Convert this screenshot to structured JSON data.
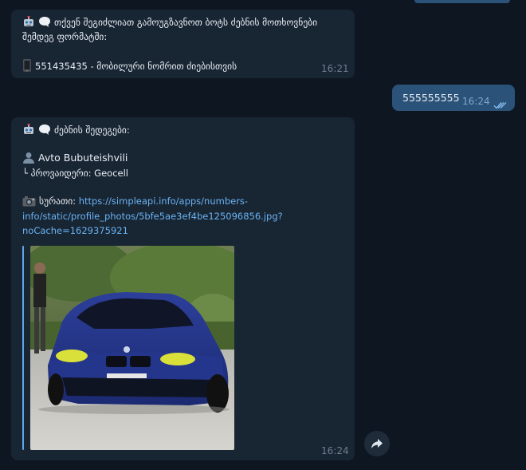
{
  "messages": {
    "bot_prompt": {
      "line1": "თქვენ შეგიძლიათ გამოუგზავნოთ ბოტს ძებნის მოთხოვნები",
      "line2": "შემდეგ ფორმატში:",
      "phone_example": "551435435 - მობილური ნომრით ძიებისთვის",
      "time": "16:21"
    },
    "user_query": {
      "text": "555555555",
      "time": "16:24"
    },
    "bot_result": {
      "header": "ძებნის შედეგები:",
      "name": "Avto Bubuteishvili",
      "provider": "└ პროვაიდერი: Geocell",
      "photo_label": "სურათი: ",
      "link_line1": "https://simpleapi.info/apps/numbers-",
      "link_line2": "info/static/profile_photos/5bfe5ae3ef4be125096856.jpg?",
      "link_line3": "noCache=1629375921",
      "time": "16:24"
    }
  },
  "colors": {
    "background": "#0e1621",
    "incoming_bubble": "#182533",
    "outgoing_bubble": "#2b5278",
    "link": "#6ab3f3"
  },
  "icons": {
    "robot": "robot-icon",
    "speech": "speech-bubble-icon",
    "phone": "mobile-phone-icon",
    "person": "person-icon",
    "camera": "camera-icon",
    "read": "double-check-icon",
    "forward": "forward-arrow-icon"
  }
}
